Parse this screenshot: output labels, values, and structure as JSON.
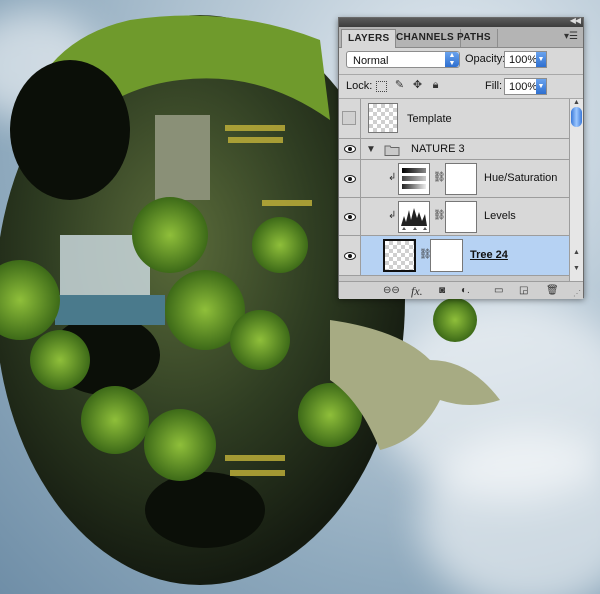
{
  "panel": {
    "tabs": [
      {
        "label": "LAYERS",
        "active": true
      },
      {
        "label": "CHANNELS",
        "active": false
      },
      {
        "label": "PATHS",
        "active": false
      }
    ],
    "blend_mode": "Normal",
    "opacity_label": "Opacity:",
    "opacity_value": "100%",
    "lock_label": "Lock:",
    "fill_label": "Fill:",
    "fill_value": "100%",
    "layers": [
      {
        "name": "Template",
        "visible": false,
        "type": "layer"
      },
      {
        "name": "NATURE 3",
        "visible": true,
        "type": "group"
      },
      {
        "name": "Hue/Saturation",
        "visible": true,
        "type": "adjustment"
      },
      {
        "name": "Levels",
        "visible": true,
        "type": "adjustment"
      },
      {
        "name": "Tree 24",
        "visible": true,
        "type": "layer",
        "selected": true
      }
    ],
    "accent_color": "#2e6fd0",
    "selection_color": "#b6d2f3"
  }
}
